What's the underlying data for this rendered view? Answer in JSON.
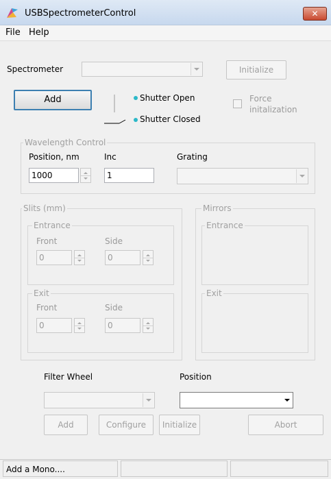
{
  "window": {
    "title": "USBSpectrometerControl",
    "close_glyph": "✕"
  },
  "menu": {
    "items": [
      "File",
      "Help"
    ]
  },
  "spectrometer": {
    "label": "Spectrometer",
    "selected": "",
    "initialize_label": "Initialize",
    "add_label": "Add"
  },
  "shutter": {
    "open_label": "Shutter Open",
    "closed_label": "Shutter Closed",
    "force_label_line1": "Force",
    "force_label_line2": "initalization",
    "force_checked": false
  },
  "wavelength": {
    "group_title": "Wavelength Control",
    "position_label": "Position, nm",
    "position_value": "1000",
    "inc_label": "Inc",
    "inc_value": "1",
    "grating_label": "Grating",
    "grating_selected": ""
  },
  "slits": {
    "group_title": "Slits (mm)",
    "entrance": {
      "title": "Entrance",
      "front_label": "Front",
      "front_value": "0",
      "side_label": "Side",
      "side_value": "0"
    },
    "exit": {
      "title": "Exit",
      "front_label": "Front",
      "front_value": "0",
      "side_label": "Side",
      "side_value": "0"
    }
  },
  "mirrors": {
    "group_title": "Mirrors",
    "entrance_title": "Entrance",
    "exit_title": "Exit"
  },
  "filter": {
    "filter_wheel_label": "Filter Wheel",
    "position_label": "Position",
    "filter_selected": "",
    "position_selected": ""
  },
  "actions": {
    "add_label": "Add",
    "configure_label": "Configure",
    "initialize_label": "Initialize",
    "abort_label": "Abort"
  },
  "status": {
    "message": "Add a Mono....",
    "panel2": "",
    "panel3": ""
  },
  "colors": {
    "accent_dot": "#2bb8c8",
    "close_button": "#c94a30",
    "group_border": "#d5d5d5"
  }
}
